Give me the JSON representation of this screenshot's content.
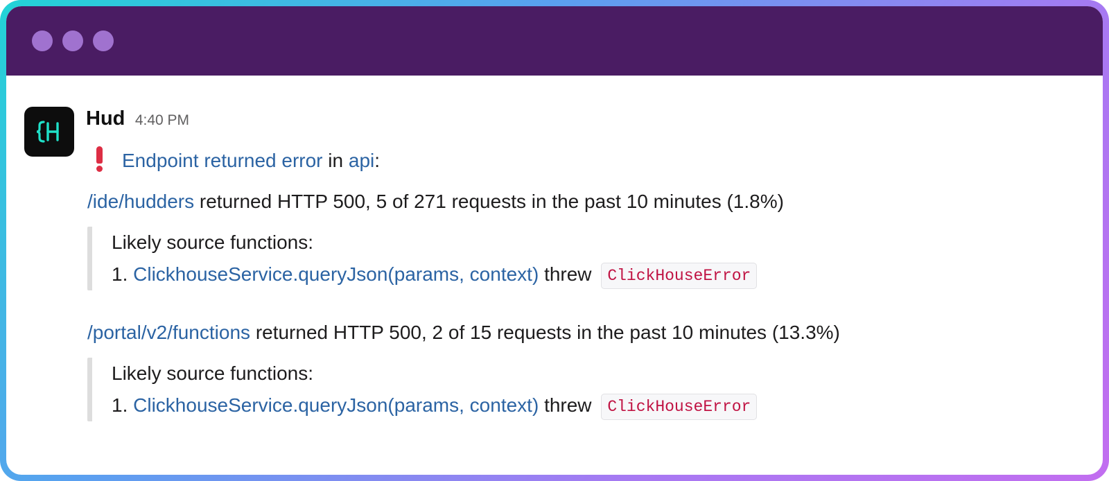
{
  "window": {
    "titlebar_color": "#4a1c63",
    "controls": [
      "window-dot",
      "window-dot",
      "window-dot"
    ]
  },
  "message": {
    "sender": "Hud",
    "time": "4:40 PM",
    "avatar_icon": "hud-logo-icon",
    "alert_icon": "exclamation-icon",
    "headline": {
      "link": "Endpoint returned error",
      "in_text": "in",
      "service": "api",
      "colon": ":"
    },
    "errors": [
      {
        "endpoint": "/ide/hudders",
        "summary": "returned HTTP 500, 5 of 271 requests in the past 10 minutes (1.8%)",
        "sources_label": "Likely source functions:",
        "item_number": "1.",
        "function": "ClickhouseService.queryJson(params, context)",
        "threw": "threw",
        "error_type": "ClickHouseError"
      },
      {
        "endpoint": "/portal/v2/functions",
        "summary": "returned HTTP 500, 2 of 15 requests in the past 10 minutes (13.3%)",
        "sources_label": "Likely source functions:",
        "item_number": "1.",
        "function": "ClickhouseService.queryJson(params, context)",
        "threw": "threw",
        "error_type": "ClickHouseError"
      }
    ]
  },
  "colors": {
    "link": "#2b63a3",
    "code_text": "#c01343",
    "alert": "#dd2e44"
  }
}
